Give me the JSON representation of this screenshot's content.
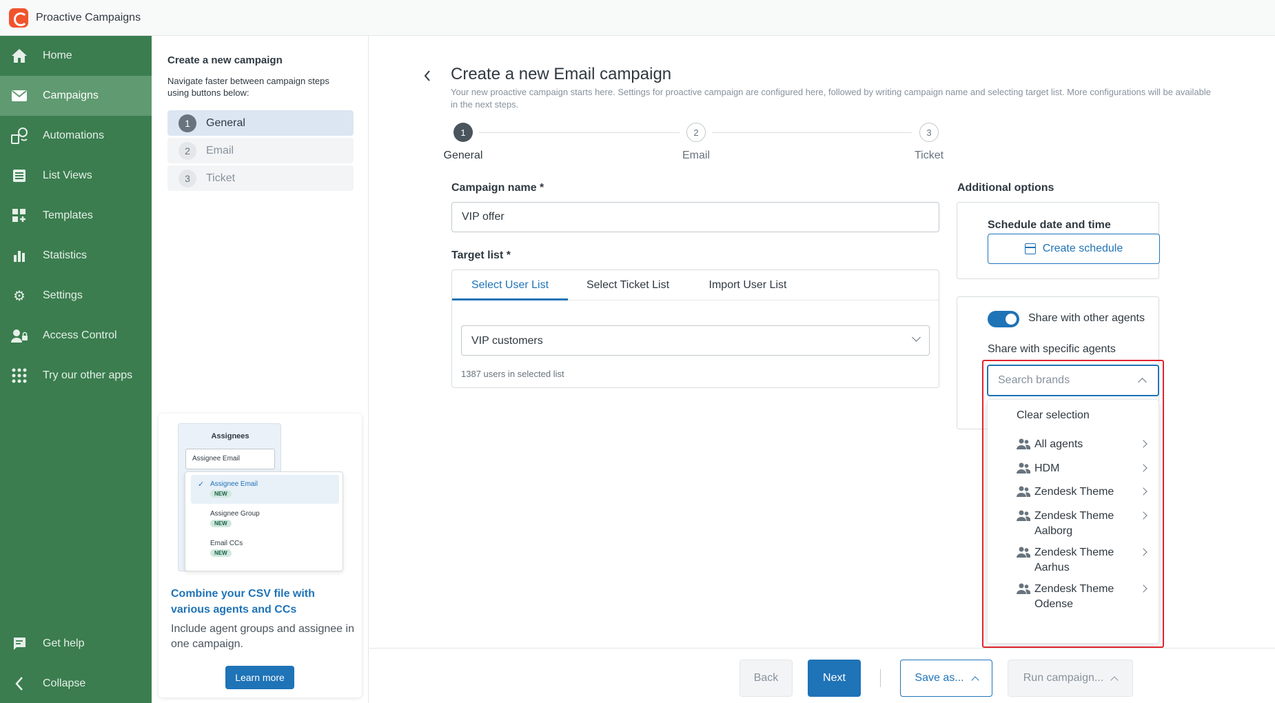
{
  "app": {
    "title": "Proactive Campaigns"
  },
  "sidebar": {
    "items": [
      {
        "label": "Home",
        "icon": "home-icon"
      },
      {
        "label": "Campaigns",
        "icon": "mail-icon",
        "active": true
      },
      {
        "label": "Automations",
        "icon": "automations-icon"
      },
      {
        "label": "List Views",
        "icon": "list-icon"
      },
      {
        "label": "Templates",
        "icon": "templates-icon"
      },
      {
        "label": "Statistics",
        "icon": "bar-chart-icon"
      },
      {
        "label": "Settings",
        "icon": "gear-icon"
      },
      {
        "label": "Access Control",
        "icon": "user-lock-icon"
      },
      {
        "label": "Try our other apps",
        "icon": "grid-dots-icon"
      }
    ],
    "bottom": [
      {
        "label": "Get help",
        "icon": "chat-icon"
      },
      {
        "label": "Collapse",
        "icon": "chevron-left-icon"
      }
    ]
  },
  "steps_panel": {
    "title": "Create a new campaign",
    "subtitle": "Navigate faster between campaign steps using buttons below:",
    "steps": [
      {
        "num": "1",
        "label": "General",
        "active": true
      },
      {
        "num": "2",
        "label": "Email"
      },
      {
        "num": "3",
        "label": "Ticket"
      }
    ],
    "promo": {
      "image": {
        "header": "Assignees",
        "select_value": "Assignee Email",
        "options": [
          {
            "label": "Assignee Email",
            "badge": "NEW"
          },
          {
            "label": "Assignee Group",
            "badge": "NEW"
          },
          {
            "label": "Email CCs",
            "badge": "NEW"
          }
        ]
      },
      "title": "Combine your CSV file with various agents and CCs",
      "body": "Include agent groups and assignee in one campaign.",
      "button": "Learn more"
    }
  },
  "main": {
    "title": "Create a new Email campaign",
    "description": "Your new proactive campaign starts here. Settings for proactive campaign are configured here, followed by writing campaign name and selecting target list. More configurations will be available in the next steps.",
    "stepper": [
      {
        "num": "1",
        "label": "General"
      },
      {
        "num": "2",
        "label": "Email"
      },
      {
        "num": "3",
        "label": "Ticket"
      }
    ],
    "campaign_name": {
      "label": "Campaign name *",
      "value": "VIP offer"
    },
    "target_list": {
      "label": "Target list *",
      "tabs": [
        "Select User List",
        "Select Ticket List",
        "Import User List"
      ],
      "selected": "VIP customers",
      "hint": "1387 users in selected list"
    },
    "additional": {
      "label": "Additional options",
      "schedule_label": "Schedule date and time",
      "schedule_button": "Create schedule",
      "share_toggle_label": "Share with other agents",
      "share_toggle_on": true,
      "specific_label": "Share with specific agents",
      "search_placeholder": "Search brands",
      "dropdown": {
        "clear": "Clear selection",
        "items": [
          "All agents",
          "HDM",
          "Zendesk Theme",
          "Zendesk Theme Aalborg",
          "Zendesk Theme Aarhus",
          "Zendesk Theme Odense"
        ]
      }
    }
  },
  "footer": {
    "back": "Back",
    "next": "Next",
    "save": "Save as...",
    "run": "Run campaign..."
  },
  "colors": {
    "sidebar": "#3b7d4f",
    "accent": "#1f73b7",
    "highlight": "#e0242f"
  }
}
